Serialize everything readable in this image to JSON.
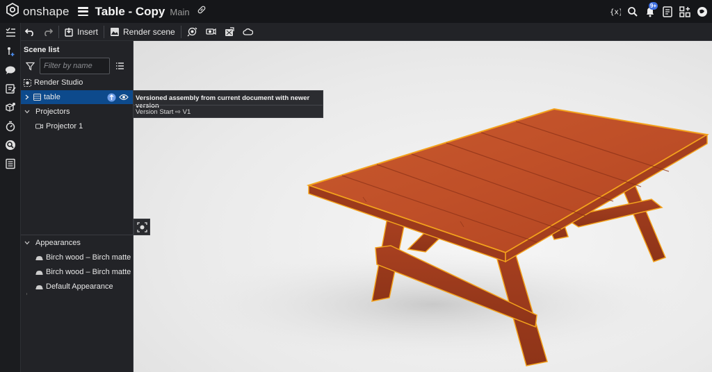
{
  "app": {
    "brand": "onshape",
    "doc_title": "Table - Copy",
    "branch": "Main",
    "notification_count": "9+"
  },
  "toolbar": {
    "insert_label": "Insert",
    "render_scene_label": "Render scene"
  },
  "scene_list": {
    "title": "Scene list",
    "filter_placeholder": "Filter by name",
    "root_label": "Render Studio",
    "table_label": "table",
    "projectors_label": "Projectors",
    "projector_item": "Projector 1",
    "appearances_label": "Appearances",
    "appearances": [
      "Birch wood – Birch matte",
      "Birch wood – Birch matte",
      "Default Appearance"
    ]
  },
  "tooltip": {
    "line1": "Versioned assembly from current document with newer version",
    "line2": "Version Start ⇨ V1"
  },
  "colors": {
    "accent": "#0d4a8c",
    "wood": "#c2512a",
    "outline": "#f3a21c"
  }
}
